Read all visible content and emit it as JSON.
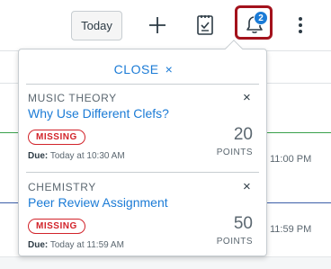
{
  "toolbar": {
    "today_label": "Today"
  },
  "notifications": {
    "badge_count": "2",
    "close_label": "CLOSE",
    "close_icon": "×",
    "items": [
      {
        "course": "MUSIC THEORY",
        "title": "Why Use Different Clefs?",
        "status": "MISSING",
        "due_label": "Due:",
        "due_value": "Today at 10:30 AM",
        "points": "20",
        "points_label": "POINTS",
        "dismiss_icon": "×"
      },
      {
        "course": "CHEMISTRY",
        "title": "Peer Review Assignment",
        "status": "MISSING",
        "due_label": "Due:",
        "due_value": "Today at 11:59 AM",
        "points": "50",
        "points_label": "POINTS",
        "dismiss_icon": "×"
      }
    ]
  },
  "background": {
    "times": [
      "11:00 PM",
      "11:59 PM"
    ]
  },
  "colors": {
    "accent": "#1b7bd6",
    "missing": "#d2232a",
    "highlight_border": "#a3121c"
  },
  "icons": [
    "plus-icon",
    "todo-list-icon",
    "bell-icon",
    "more-vertical-icon",
    "close-icon"
  ]
}
